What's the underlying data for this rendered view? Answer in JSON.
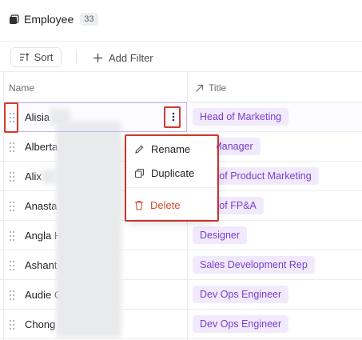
{
  "header": {
    "title": "Employee",
    "count": "33",
    "icon": "database-icon"
  },
  "toolbar": {
    "sort_label": "Sort",
    "add_filter_label": "Add Filter"
  },
  "table": {
    "columns": [
      "Name",
      "Title"
    ],
    "rows": [
      {
        "name": "Alisia",
        "title": "Head of Marketing"
      },
      {
        "name": "Alberta",
        "title": "rts Manager"
      },
      {
        "name": "Alix",
        "title": "ctor of Product Marketing"
      },
      {
        "name": "Anasta",
        "title": "ctor of FP&A"
      },
      {
        "name": "Angla H",
        "title": "Designer"
      },
      {
        "name": "Ashant",
        "title": "Sales Development Rep"
      },
      {
        "name": "Audie C",
        "title": "Dev Ops Engineer"
      },
      {
        "name": "Chong",
        "title": "Dev Ops Engineer"
      }
    ]
  },
  "context_menu": {
    "rename": "Rename",
    "duplicate": "Duplicate",
    "delete": "Delete"
  },
  "colors": {
    "accent_purple": "#7a3fcf",
    "pill_bg": "#f1eafd",
    "highlight_red": "#d33a2c",
    "delete_red": "#d64a31"
  }
}
